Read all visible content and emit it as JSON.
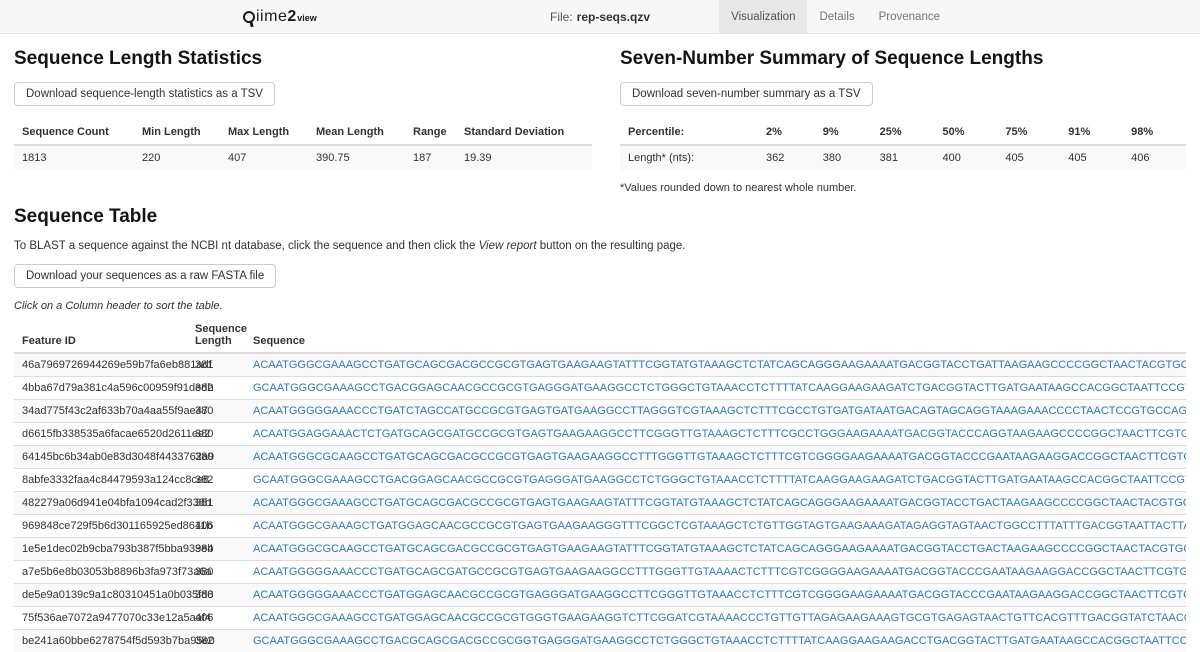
{
  "header": {
    "logo": {
      "brand": "iime",
      "brand_num": "2",
      "brand_sub": "view"
    },
    "file_label": "File:",
    "file_name": "rep-seqs.qzv",
    "tabs": [
      {
        "label": "Visualization"
      },
      {
        "label": "Details"
      },
      {
        "label": "Provenance"
      }
    ]
  },
  "length_stats": {
    "title": "Sequence Length Statistics",
    "download_button": "Download sequence-length statistics as a TSV",
    "headers": [
      "Sequence Count",
      "Min Length",
      "Max Length",
      "Mean Length",
      "Range",
      "Standard Deviation"
    ],
    "values": [
      "1813",
      "220",
      "407",
      "390.75",
      "187",
      "19.39"
    ]
  },
  "seven_number": {
    "title": "Seven-Number Summary of Sequence Lengths",
    "download_button": "Download seven-number summary as a TSV",
    "row1_label": "Percentile:",
    "percentiles": [
      "2%",
      "9%",
      "25%",
      "50%",
      "75%",
      "91%",
      "98%"
    ],
    "row2_label": "Length* (nts):",
    "lengths": [
      "362",
      "380",
      "381",
      "400",
      "405",
      "405",
      "406"
    ],
    "footnote": "*Values rounded down to nearest whole number."
  },
  "sequence_table": {
    "title": "Sequence Table",
    "blast_prefix": "To BLAST a sequence against the NCBI nt database, click the sequence and then click the ",
    "blast_italic": "View report",
    "blast_suffix": " button on the resulting page.",
    "download_button": "Download your sequences as a raw FASTA file",
    "sort_hint": "Click on a Column header to sort the table.",
    "columns": [
      "Feature ID",
      "Sequence Length",
      "Sequence"
    ],
    "rows": [
      {
        "id": "46a7969726944269e59b7fa6eb881adf",
        "length": "381",
        "seq": "ACAATGGGCGAAAGCCTGATGCAGCGACGCCGCGTGAGTGAAGAAGTATTTCGGTATGTAAAGCTCTATCAGCAGGGAAGAAAATGACGGTACCTGATTAAGAAGCCCCGGCTAACTACGTGCCAGCAGCCGCGGTAATACGTAGGGGGCAAGCG"
      },
      {
        "id": "4bba67d79a381c4a596c00959f91dedb",
        "length": "382",
        "seq": "GCAATGGGCGAAAGCCTGACGGAGCAACGCCGCGTGAGGGATGAAGGCCTCTGGGCTGTAAACCTCTTTTATCAAGGAAGAAGATCTGACGGTACTTGATGAATAAGCCACGGCTAATTCCGTGCCAGCAGCCGCGGTAATACGGAGTGGGCAAG"
      },
      {
        "id": "34ad775f43c2af633b70a4aa55f9ae47",
        "length": "380",
        "seq": "ACAATGGGGGAAACCCTGATCTAGCCATGCCGCGTGAGTGATGAAGGCCTTAGGGTCGTAAAGCTCTTTCGCCTGTGATGATAATGACAGTAGCAGGTAAAGAAACCCCTAACTCCGTGCCAGCAGCCGCGGTAATACGGAGGGGGTTAGCGTTG"
      },
      {
        "id": "d6615fb338535a6facae6520d2611ee2",
        "length": "380",
        "seq": "ACAATGGAGGAAACTCTGATGCAGCGATGCCGCGTGAGTGAAGAAGGCCTTCGGGTTGTAAAGCTCTTTCGCCTGGGAAGAAAATGACGGTACCCAGGTAAGAAGCCCCGGCTAACTTCGTGCCAGCAGCCGCGGTAATACGAAGGGGGCTAGCG"
      },
      {
        "id": "64145bc6b34ab0e83d3048f4433762a9",
        "length": "380",
        "seq": "ACAATGGGCGCAAGCCTGATGCAGCGACGCCGCGTGAGTGAAGAAGGCCTTTGGGTTGTAAAGCTCTTTCGTCGGGGAAGAAAATGACGGTACCCGAATAAGAAGGACCGGCTAACTTCGTGCCAGCAGCCGCGGTAATACGAAGGGGGCTAGCG"
      },
      {
        "id": "8abfe3332faa4c84479593a124cc8ce8",
        "length": "382",
        "seq": "GCAATGGGCGAAAGCCTGACGGAGCAACGCCGCGTGAGGGATGAAGGCCTCTGGGCTGTAAACCTCTTTTATCAAGGAAGAAGATCTGACGGTACTTGATGAATAAGCCACGGCTAATTCCGTGCCAGCAGCCGCGGTAATACGGAGTGGGCAAG"
      },
      {
        "id": "482279a06d941e04bfa1094cad2f338b",
        "length": "381",
        "seq": "ACAATGGGCGAAAGCCTGATGCAGCGACGCCGCGTGAGTGAAGAAGTATTTCGGTATGTAAAGCTCTATCAGCAGGGAAGAAAATGACGGTACCTGACTAAGAAGCCCCGGCTAACTACGTGCCAGCAGCCGCGGTAATACGTAGGGGGCAAGCG"
      },
      {
        "id": "969848ce729f5b6d301165925ed8611b",
        "length": "406",
        "seq": "ACAATGGGCGAAAGCTGATGGAGCAACGCCGCGTGAGTGAAGAAGGGTTTCGGCTCGTAAAGCTCTGTTGGTAGTGAAGAAAGATAGAGGTAGTAACTGGCCTTTATTTGACGGTAATTACTTAGAAAGTCACGGCTAACTACGTGCCAGCAGCC"
      },
      {
        "id": "1e5e1dec02b9cba793b387f5bba939eb",
        "length": "384",
        "seq": "ACAATGGGCGCAAGCCTGATGCAGCGACGCCGCGTGAGTGAAGAAGTATTTCGGTATGTAAAGCTCTATCAGCAGGGAAGAAAATGACGGTACCTGACTAAGAAGCCCCGGCTAACTACGTGCCAGCAGCCGCGGTAATACGTAGGGGGCAAGCG"
      },
      {
        "id": "a7e5b6e8b03053b8896b3fa973f73a6a",
        "length": "380",
        "seq": "ACAATGGGGGAAACCCTGATGCAGCGATGCCGCGTGAGTGAAGAAGGCCTTTGGGTTGTAAAACTCTTTCGTCGGGGAAGAAAATGACGGTACCCGAATAAGAAGGACCGGCTAACTTCGTGCCAGCAGCCGCGGTAATACGAAGGGGGCTAGCG"
      },
      {
        "id": "de5e9a0139c9a1c80310451a0b035fd8",
        "length": "380",
        "seq": "ACAATGGGGGAAACCCTGATGGAGCAACGCCGCGTGAGGGATGAAGGCCTTCGGGTTGTAAACCTCTTTCGTCGGGGAAGAAAATGACGGTACCCGAATAAGAAGGACCGGCTAACTTCGTGCCAGCAGCCGCGGTAATACGAAGGGGGCTAGCG"
      },
      {
        "id": "75f536ae7072a9477070c33e12a5aaf4",
        "length": "406",
        "seq": "ACAATGGGCGAAAGCCTGATGGAGCAACGCCGCGTGGGTGAAGAAGGTCTTCGGATCGTAAAACCCTGTTGTTAGAGAAGAAAGTGCGTGAGAGTAACTGTTCACGTTTGACGGTATCTAACCAGAAAGCCACGGCTAACTACGTGCCAGCAGCC"
      },
      {
        "id": "be241a60bbe6278754f5d593b7ba95e0",
        "length": "382",
        "seq": "GCAATGGGCGAAAGCCTGACGCAGCGACGCCGCGGTGAGGGATGAAGGCCTCTGGGCTGTAAACCTCTTTTATCAAGGAAGAAGACCTGACGGTACTTGATGAATAAGCCACGGCTAATTCCGTGCCAGCAGCCGCGGTAATACGGAGTGGGCAA"
      }
    ]
  }
}
